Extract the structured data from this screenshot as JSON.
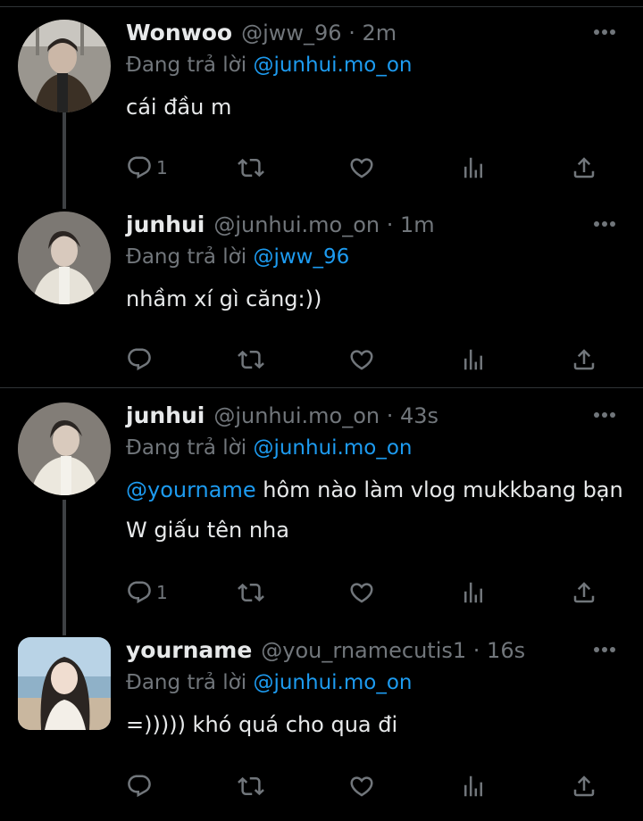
{
  "tweets": [
    {
      "name": "Wonwoo",
      "handle": "@jww_96",
      "time": "2m",
      "reply_prefix": "Đang trả lời",
      "reply_to": "@junhui.mo_on",
      "text_mention": "",
      "text": "cái đầu m",
      "reply_count": "1"
    },
    {
      "name": "junhui",
      "handle": "@junhui.mo_on",
      "time": "1m",
      "reply_prefix": "Đang trả lời",
      "reply_to": "@jww_96",
      "text_mention": "",
      "text": "nhầm xí gì căng:))",
      "reply_count": ""
    },
    {
      "name": "junhui",
      "handle": "@junhui.mo_on",
      "time": "43s",
      "reply_prefix": "Đang trả lời",
      "reply_to": "@junhui.mo_on",
      "text_mention": "@yourname",
      "text": " hôm nào làm vlog mukkbang bạn W giấu tên nha",
      "reply_count": "1"
    },
    {
      "name": "yourname",
      "handle": "@you_rnamecutis1",
      "time": "16s",
      "reply_prefix": "Đang trả lời",
      "reply_to": "@junhui.mo_on",
      "text_mention": "",
      "text": "=))))) khó quá cho qua đi",
      "reply_count": ""
    }
  ],
  "icons": {
    "reply": "reply-icon",
    "retweet": "retweet-icon",
    "like": "heart-icon",
    "views": "views-icon",
    "share": "share-icon",
    "more": "more-icon"
  },
  "colors": {
    "background": "#000000",
    "text": "#e7e9ea",
    "muted": "#71767b",
    "mention": "#1d9bf0",
    "divider": "#2f3336"
  }
}
